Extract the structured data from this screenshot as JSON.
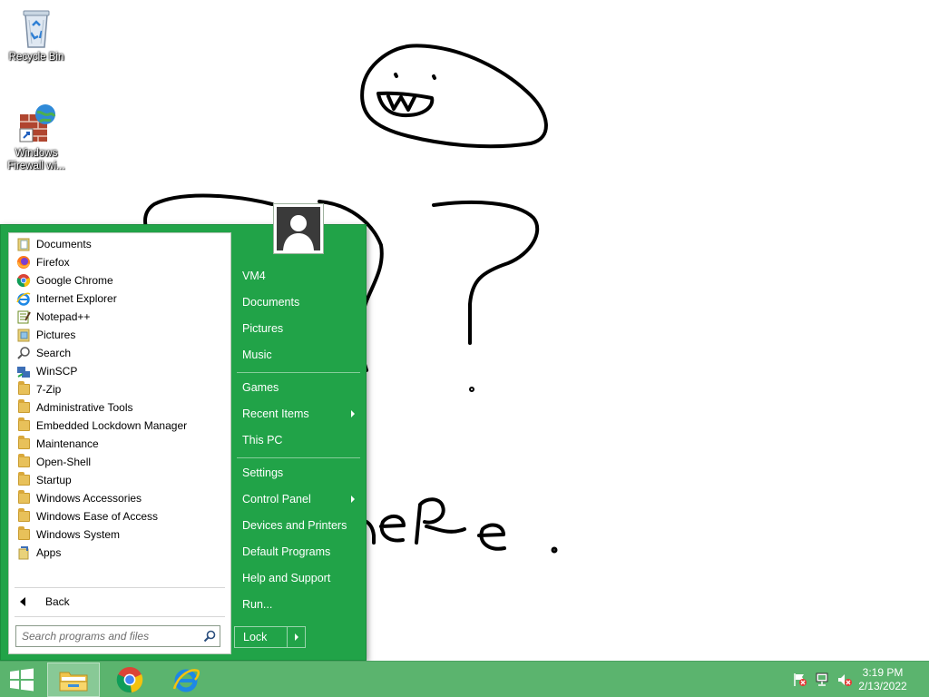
{
  "desktop": {
    "icons": [
      {
        "label": "Recycle Bin",
        "icon": "recycle-bin-icon"
      },
      {
        "label_line1": "Windows",
        "label_line2": "Firewall wi...",
        "icon": "firewall-icon"
      }
    ]
  },
  "start_menu": {
    "programs": [
      {
        "label": "Documents",
        "icon": "documents-folder-icon"
      },
      {
        "label": "Firefox",
        "icon": "firefox-icon"
      },
      {
        "label": "Google Chrome",
        "icon": "chrome-icon"
      },
      {
        "label": "Internet Explorer",
        "icon": "internet-explorer-icon"
      },
      {
        "label": "Notepad++",
        "icon": "notepad-plus-plus-icon"
      },
      {
        "label": "Pictures",
        "icon": "pictures-folder-icon"
      },
      {
        "label": "Search",
        "icon": "search-icon"
      },
      {
        "label": "WinSCP",
        "icon": "winscp-icon"
      },
      {
        "label": "7-Zip",
        "icon": "folder-icon"
      },
      {
        "label": "Administrative Tools",
        "icon": "folder-icon"
      },
      {
        "label": "Embedded Lockdown Manager",
        "icon": "folder-icon"
      },
      {
        "label": "Maintenance",
        "icon": "folder-icon"
      },
      {
        "label": "Open-Shell",
        "icon": "folder-icon"
      },
      {
        "label": "Startup",
        "icon": "folder-icon"
      },
      {
        "label": "Windows Accessories",
        "icon": "folder-icon"
      },
      {
        "label": "Windows Ease of Access",
        "icon": "folder-icon"
      },
      {
        "label": "Windows System",
        "icon": "folder-icon"
      },
      {
        "label": "Apps",
        "icon": "apps-icon"
      }
    ],
    "back_label": "Back",
    "search_placeholder": "Search programs and files",
    "right_items": [
      {
        "label": "VM4"
      },
      {
        "label": "Documents"
      },
      {
        "label": "Pictures"
      },
      {
        "label": "Music"
      },
      {
        "label": "Games"
      },
      {
        "label": "Recent Items",
        "submenu": true
      },
      {
        "label": "This PC"
      },
      {
        "label": "Settings"
      },
      {
        "label": "Control Panel",
        "submenu": true
      },
      {
        "label": "Devices and Printers"
      },
      {
        "label": "Default Programs"
      },
      {
        "label": "Help and Support"
      },
      {
        "label": "Run..."
      }
    ],
    "lock_label": "Lock",
    "accent_color": "#21a348"
  },
  "taskbar": {
    "color": "#5bb46e",
    "pinned": [
      {
        "icon": "file-explorer-icon",
        "active": true
      },
      {
        "icon": "chrome-icon",
        "active": false
      },
      {
        "icon": "internet-explorer-icon",
        "active": false
      }
    ],
    "tray_icons": [
      "action-center-flag-icon",
      "network-icon",
      "volume-muted-icon"
    ],
    "time": "3:19 PM",
    "date": "2/13/2022"
  }
}
